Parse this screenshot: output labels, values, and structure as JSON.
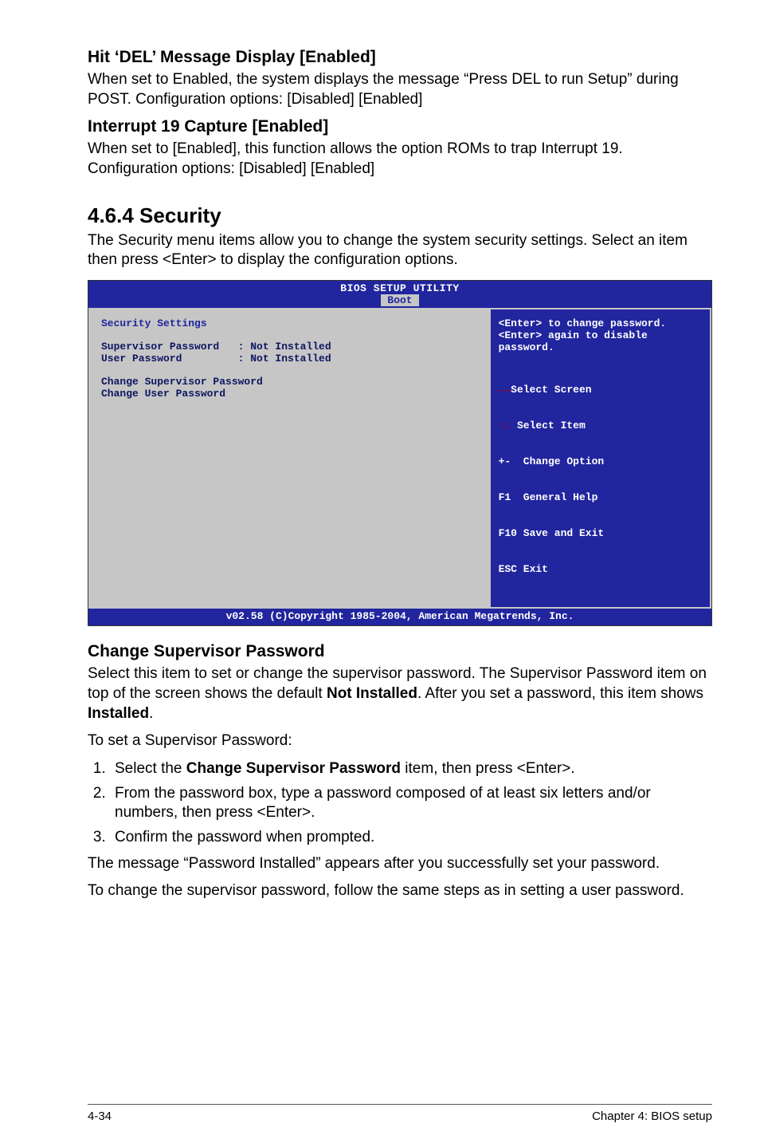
{
  "sections": {
    "hitDel": {
      "heading": "Hit ‘DEL’ Message Display [Enabled]",
      "body": "When set to Enabled, the system displays the message “Press DEL to run Setup” during POST. Configuration options: [Disabled] [Enabled]"
    },
    "int19": {
      "heading": "Interrupt 19 Capture [Enabled]",
      "body": "When set to [Enabled], this function allows the option ROMs to trap Interrupt 19. Configuration options: [Disabled] [Enabled]"
    },
    "security": {
      "heading": "4.6.4 Security",
      "intro": "The Security menu items allow you to change the system security settings. Select an item then press <Enter> to display the configuration options."
    },
    "changeSup": {
      "heading": "Change Supervisor Password",
      "p1a": "Select this item to set or change the supervisor password. The Supervisor Password item on top of the screen shows the default ",
      "p1b": "Not Installed",
      "p1c": ". After you set a password, this item shows ",
      "p1d": "Installed",
      "p1e": ".",
      "p2": "To set a Supervisor Password:",
      "steps": {
        "s1a": "Select the ",
        "s1b": "Change Supervisor Password",
        "s1c": " item, then press <Enter>.",
        "s2": "From the password box, type a password composed of at least six letters and/or numbers, then press <Enter>.",
        "s3": "Confirm the password when prompted."
      },
      "p3": "The message “Password Installed” appears after you successfully set your password.",
      "p4": "To change the supervisor password, follow the same steps as in setting a user password."
    }
  },
  "bios": {
    "title": "BIOS SETUP UTILITY",
    "tab": "Boot",
    "left": {
      "heading": "Security Settings",
      "row1": "Supervisor Password   : Not Installed",
      "row2": "User Password         : Not Installed",
      "row3": "Change Supervisor Password",
      "row4": "Change User Password"
    },
    "right": {
      "help1": "<Enter> to change password.",
      "help2": "<Enter> again to disable password.",
      "nav1": "Select Screen",
      "nav2": "Select Item",
      "nav3": "+-  Change Option",
      "nav4": "F1  General Help",
      "nav5": "F10 Save and Exit",
      "nav6": "ESC Exit"
    },
    "footer": "v02.58 (C)Copyright 1985-2004, American Megatrends, Inc."
  },
  "footer": {
    "left": "4-34",
    "right": "Chapter 4: BIOS setup"
  }
}
